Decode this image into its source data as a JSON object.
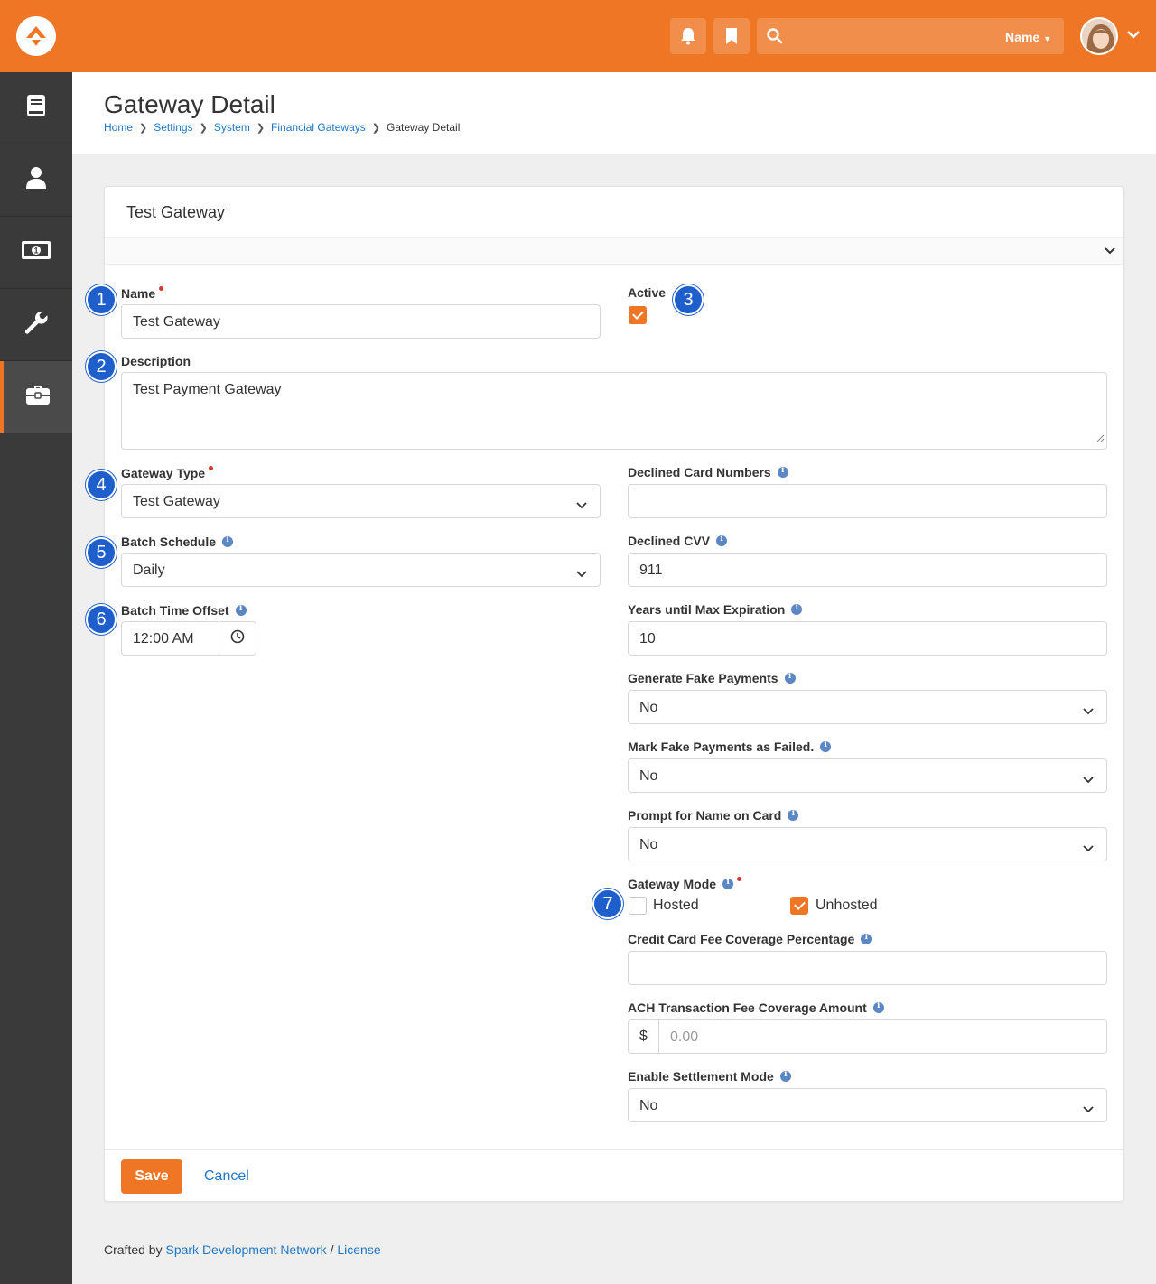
{
  "topbar": {
    "search_name_label": "Name",
    "icons": {
      "logo": "rock-logo-icon",
      "notifications": "bell-icon",
      "bookmarks": "bookmark-icon",
      "search": "search-icon"
    }
  },
  "sidebar": {
    "items": [
      {
        "name": "book-icon"
      },
      {
        "name": "person-icon"
      },
      {
        "name": "money-icon"
      },
      {
        "name": "wrench-icon"
      },
      {
        "name": "briefcase-icon",
        "active": true
      }
    ]
  },
  "header": {
    "title": "Gateway Detail",
    "breadcrumbs": [
      "Home",
      "Settings",
      "System",
      "Financial Gateways"
    ],
    "current": "Gateway Detail"
  },
  "panel": {
    "title": "Test Gateway"
  },
  "form": {
    "name": {
      "label": "Name",
      "value": "Test Gateway"
    },
    "active": {
      "label": "Active",
      "checked": true
    },
    "description": {
      "label": "Description",
      "value": "Test Payment Gateway"
    },
    "gateway_type": {
      "label": "Gateway Type",
      "value": "Test Gateway"
    },
    "batch_schedule": {
      "label": "Batch Schedule",
      "value": "Daily"
    },
    "batch_time_offset": {
      "label": "Batch Time Offset",
      "value": "12:00 AM"
    },
    "declined_card_numbers": {
      "label": "Declined Card Numbers",
      "value": ""
    },
    "declined_cvv": {
      "label": "Declined CVV",
      "value": "911"
    },
    "years_until_max_expiration": {
      "label": "Years until Max Expiration",
      "value": "10"
    },
    "generate_fake_payments": {
      "label": "Generate Fake Payments",
      "value": "No"
    },
    "mark_fake_payments_failed": {
      "label": "Mark Fake Payments as Failed.",
      "value": "No"
    },
    "prompt_name_on_card": {
      "label": "Prompt for Name on Card",
      "value": "No"
    },
    "gateway_mode": {
      "label": "Gateway Mode",
      "hosted_label": "Hosted",
      "hosted_checked": false,
      "unhosted_label": "Unhosted",
      "unhosted_checked": true
    },
    "cc_fee_coverage": {
      "label": "Credit Card Fee Coverage Percentage",
      "value": ""
    },
    "ach_fee_coverage": {
      "label": "ACH Transaction Fee Coverage Amount",
      "addon": "$",
      "placeholder": "0.00"
    },
    "enable_settlement_mode": {
      "label": "Enable Settlement Mode",
      "value": "No"
    }
  },
  "markers": [
    "1",
    "2",
    "3",
    "4",
    "5",
    "6",
    "7"
  ],
  "actions": {
    "save": "Save",
    "cancel": "Cancel"
  },
  "footer": {
    "prefix": "Crafted by",
    "org": "Spark Development Network",
    "sep": "/",
    "license": "License"
  },
  "colors": {
    "accent": "#ee7625",
    "link": "#2077c7",
    "marker": "#1f5fcc",
    "required": "#d9362b"
  }
}
